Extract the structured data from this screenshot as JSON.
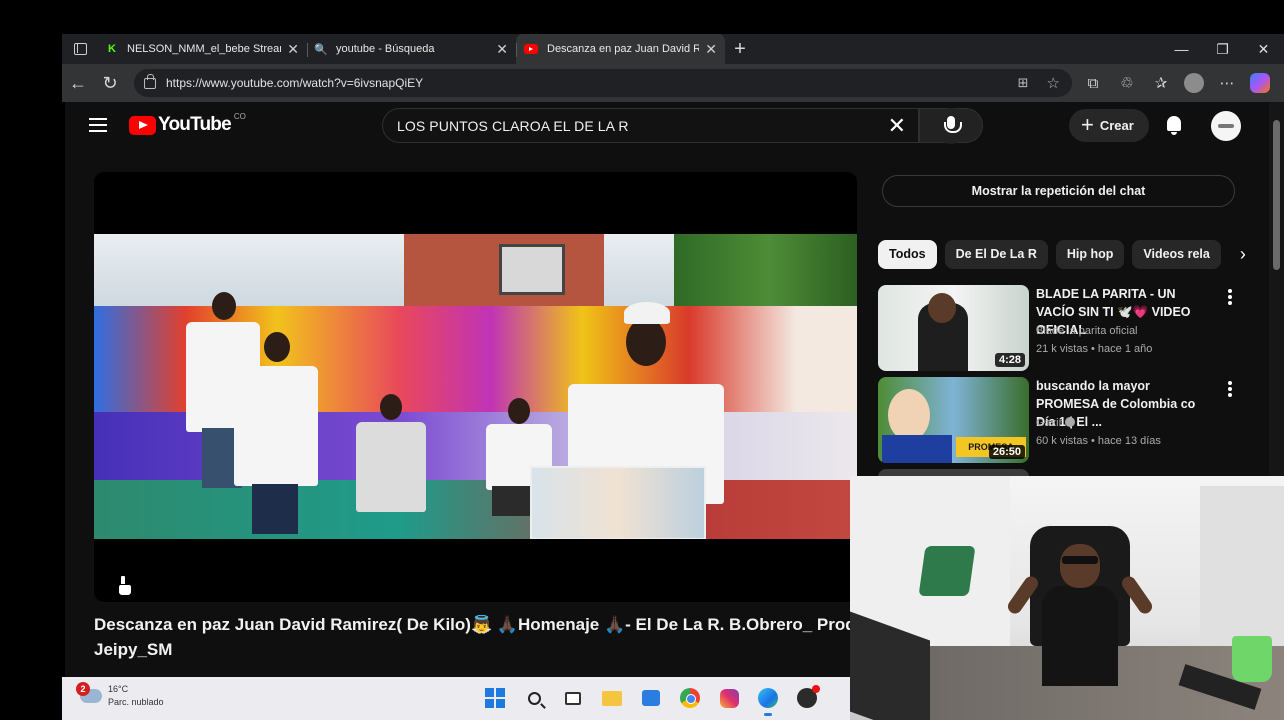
{
  "browser": {
    "tabs": [
      {
        "title": "NELSON_NMM_el_bebe Stream -",
        "favicon": "kick-icon",
        "active": false
      },
      {
        "title": "youtube - Búsqueda",
        "favicon": "search-icon",
        "active": false
      },
      {
        "title": "Descanza en paz Juan David Ram",
        "favicon": "youtube-icon",
        "active": true
      }
    ],
    "url": "https://www.youtube.com/watch?v=6ivsnapQiEY",
    "window_controls": [
      "—",
      "❐",
      "✕"
    ]
  },
  "youtube": {
    "logo": "YouTube",
    "region": "CO",
    "search_query": "LOS PUNTOS CLAROA EL DE LA R",
    "create_label": "Crear",
    "video_title": "Descanza en paz Juan David Ramirez( De Kilo)👼 🙏🏿Homenaje 🙏🏿- El De La R. B.Obrero_ Prod. Jeipy_SM",
    "chat_replay_label": "Mostrar la repetición del chat",
    "chips": [
      "Todos",
      "De El De La R",
      "Hip hop",
      "Videos rela"
    ],
    "recommendations": [
      {
        "title": "BLADE LA PARITA - UN VACÍO SIN TI 🕊️💗 VIDEO OFICIAL",
        "channel": "Blade la parita oficial",
        "meta": "21 k vistas • hace 1 año",
        "duration": "4:28"
      },
      {
        "title": "buscando la mayor PROMESA de Colombia co Día 1 | El ...",
        "channel": "Gazir",
        "meta": "60 k vistas • hace 13 días",
        "duration": "26:50"
      }
    ]
  },
  "taskbar": {
    "weather_temp": "16°C",
    "weather_desc": "Parc. nublado",
    "notification_count": "2"
  },
  "colors": {
    "yt_red": "#ff0000",
    "yt_bg": "#0f0f0f",
    "chip_active_bg": "#f1f1f1"
  }
}
